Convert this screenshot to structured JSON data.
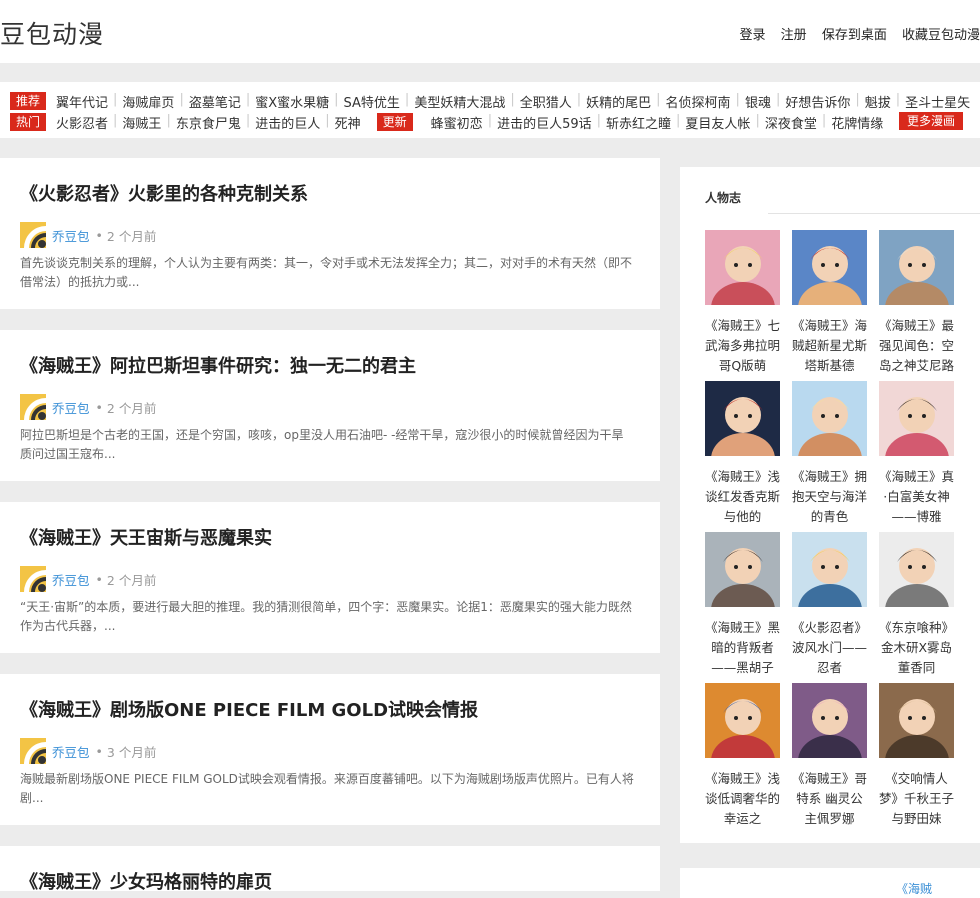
{
  "site": {
    "title": "豆包动漫"
  },
  "header": {
    "links": [
      "登录",
      "注册",
      "保存到桌面",
      "收藏豆包动漫"
    ]
  },
  "nav": {
    "rec_label": "推荐",
    "rec_items": [
      "翼年代记",
      "海贼扉页",
      "盗墓笔记",
      "蜜X蜜水果糖",
      "SA特优生",
      "美型妖精大混战",
      "全职猎人",
      "妖精的尾巴",
      "名侦探柯南",
      "银魂",
      "好想告诉你",
      "魁拔",
      "圣斗士星矢"
    ],
    "hot_label": "热门",
    "hot_items": [
      "火影忍者",
      "海贼王",
      "东京食尸鬼",
      "进击的巨人",
      "死神"
    ],
    "update_label": "更新",
    "update_items": [
      "蜂蜜初恋",
      "进击的巨人59话",
      "斩赤红之瞳",
      "夏目友人帐",
      "深夜食堂",
      "花牌情缘"
    ],
    "more_label": "更多漫画"
  },
  "posts": [
    {
      "title": "《火影忍者》火影里的各种克制关系",
      "author": "乔豆包",
      "time": "2 个月前",
      "excerpt": "首先谈谈克制关系的理解，个人认为主要有两类：其一，令对手或术无法发挥全力；其二，对对手的术有天然（即不借常法）的抵抗力或..."
    },
    {
      "title": "《海贼王》阿拉巴斯坦事件研究：独一无二的君主",
      "author": "乔豆包",
      "time": "2 个月前",
      "excerpt": "阿拉巴斯坦是个古老的王国，还是个穷国，咳咳，op里没人用石油吧- -经常干旱，寇沙很小的时候就曾经因为干旱质问过国王寇布..."
    },
    {
      "title": "《海贼王》天王宙斯与恶魔果实",
      "author": "乔豆包",
      "time": "2 个月前",
      "excerpt": "“天王·宙斯”的本质，要进行最大胆的推理。我的猜测很简单，四个字：恶魔果实。论据1：恶魔果实的强大能力既然作为古代兵器，..."
    },
    {
      "title": "《海贼王》剧场版ONE PIECE FILM GOLD试映会情报",
      "author": "乔豆包",
      "time": "3 个月前",
      "excerpt": "海贼最新剧场版ONE PIECE FILM GOLD试映会观看情报。来源百度蕃铺吧。以下为海贼剧场版声优照片。已有人将剧..."
    },
    {
      "title": "《海贼王》少女玛格丽特的扉页",
      "author": "",
      "time": "",
      "excerpt": ""
    }
  ],
  "sidebar": {
    "title": "人物志",
    "items": [
      {
        "caption": "《海贼王》七武海多弗拉明哥Q版萌",
        "icon": "doflamingo-image"
      },
      {
        "caption": "《海贼王》海贼超新星尤斯塔斯基德",
        "icon": "kid-image"
      },
      {
        "caption": "《海贼王》最强见闻色：空岛之神艾尼路",
        "icon": "enel-image"
      },
      {
        "caption": "《海贼王》浅谈红发香克斯与他的",
        "icon": "shanks-image"
      },
      {
        "caption": "《海贼王》拥抱天空与海洋的青色",
        "icon": "marco-image"
      },
      {
        "caption": "《海贼王》真·白富美女神——博雅",
        "icon": "hancock-image"
      },
      {
        "caption": "《海贼王》黑暗的背叛者——黑胡子",
        "icon": "blackbeard-image"
      },
      {
        "caption": "《火影忍者》波风水门——忍者",
        "icon": "minato-image"
      },
      {
        "caption": "《东京喰种》金木研X雾岛董香同",
        "icon": "tokyo-ghoul-image"
      },
      {
        "caption": "《海贼王》浅谈低调奢华的幸运之",
        "icon": "buggy-image"
      },
      {
        "caption": "《海贼王》哥特系 幽灵公主佩罗娜",
        "icon": "perona-image"
      },
      {
        "caption": "《交响情人梦》千秋王子与野田妹",
        "icon": "nodame-image"
      }
    ]
  },
  "sidebar2": {
    "text": "《海贼"
  }
}
